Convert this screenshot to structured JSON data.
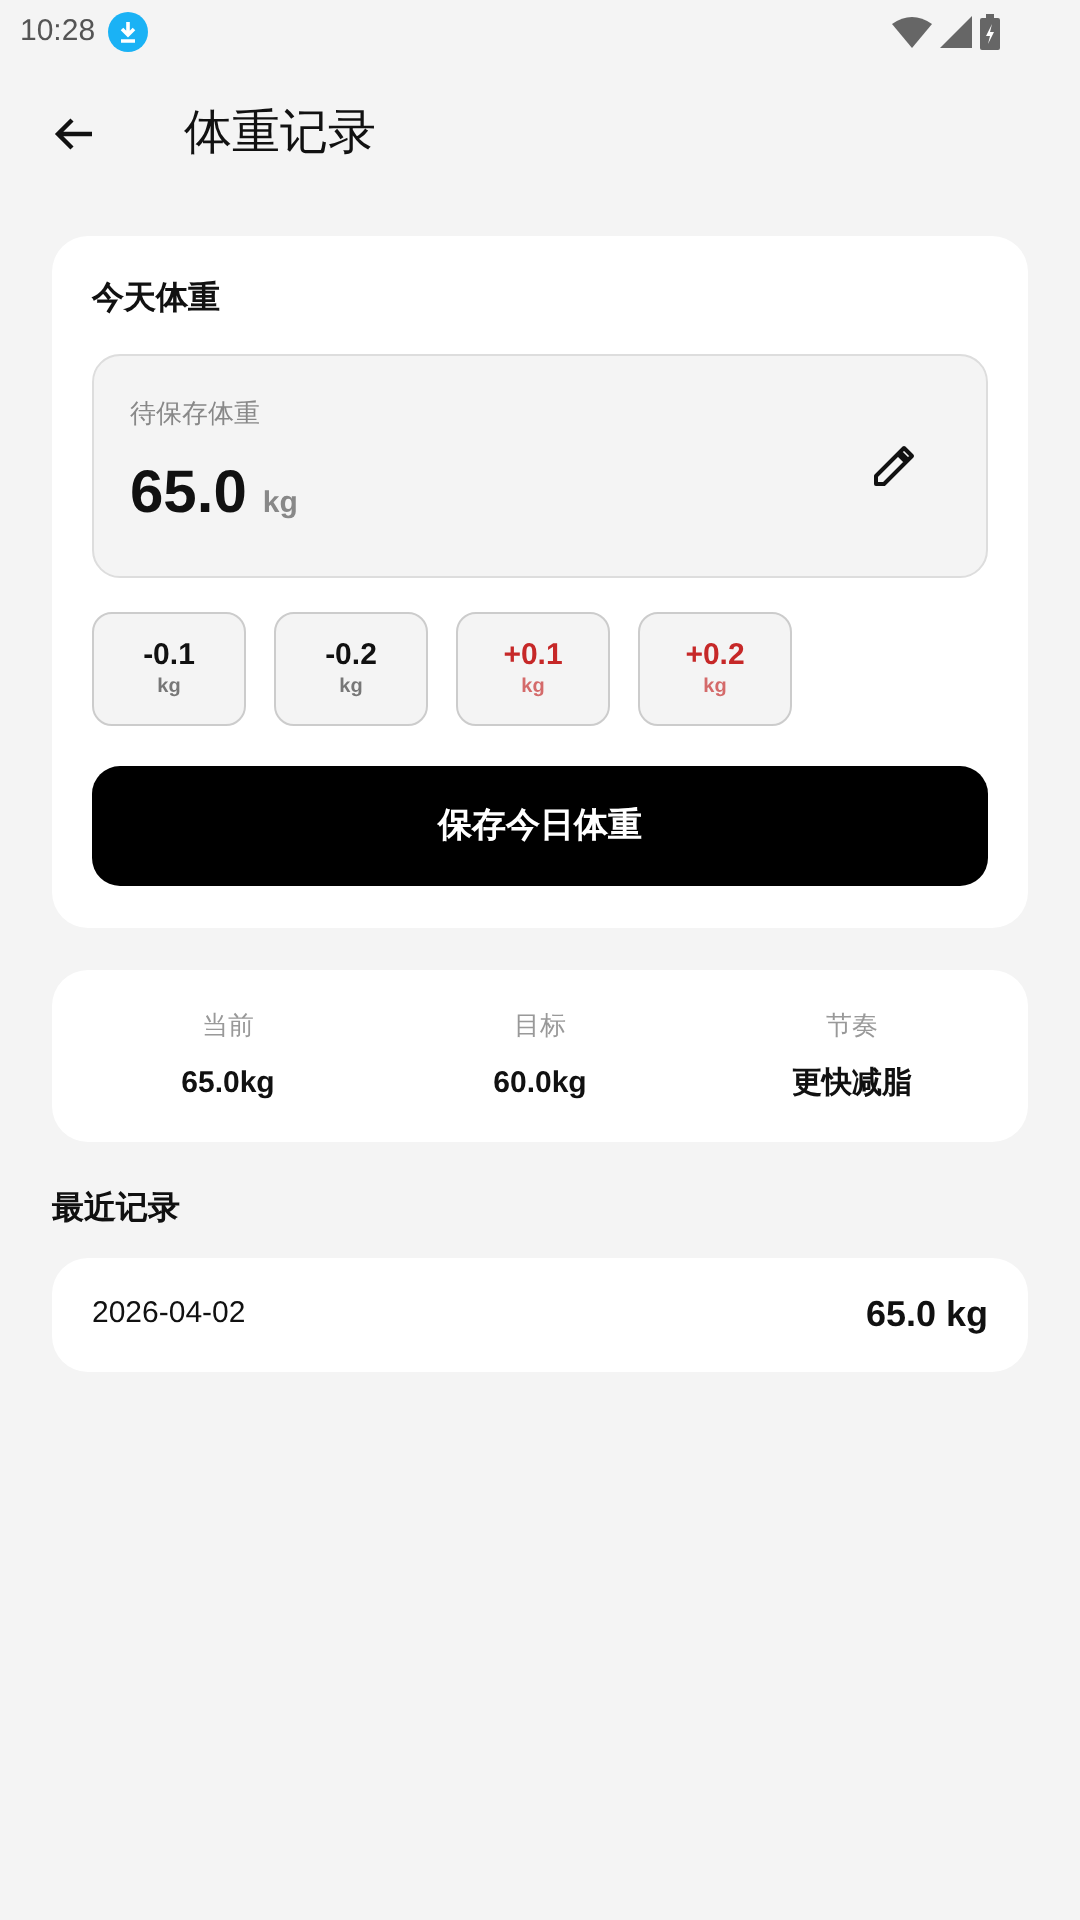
{
  "status_bar": {
    "time": "10:28"
  },
  "header": {
    "title": "体重记录"
  },
  "today_card": {
    "title": "今天体重",
    "field_label": "待保存体重",
    "value": "65.0",
    "unit": "kg",
    "adjust_buttons": [
      {
        "kind": "decrease",
        "amount": "-0.1",
        "unit": "kg"
      },
      {
        "kind": "decrease",
        "amount": "-0.2",
        "unit": "kg"
      },
      {
        "kind": "increase",
        "amount": "+0.1",
        "unit": "kg"
      },
      {
        "kind": "increase",
        "amount": "+0.2",
        "unit": "kg"
      }
    ],
    "save_button": "保存今日体重"
  },
  "stats": [
    {
      "label": "当前",
      "value": "65.0kg"
    },
    {
      "label": "目标",
      "value": "60.0kg"
    },
    {
      "label": "节奏",
      "value": "更快减脂"
    }
  ],
  "recent": {
    "title": "最近记录",
    "records": [
      {
        "date": "2026-04-02",
        "weight": "65.0 kg"
      }
    ]
  }
}
